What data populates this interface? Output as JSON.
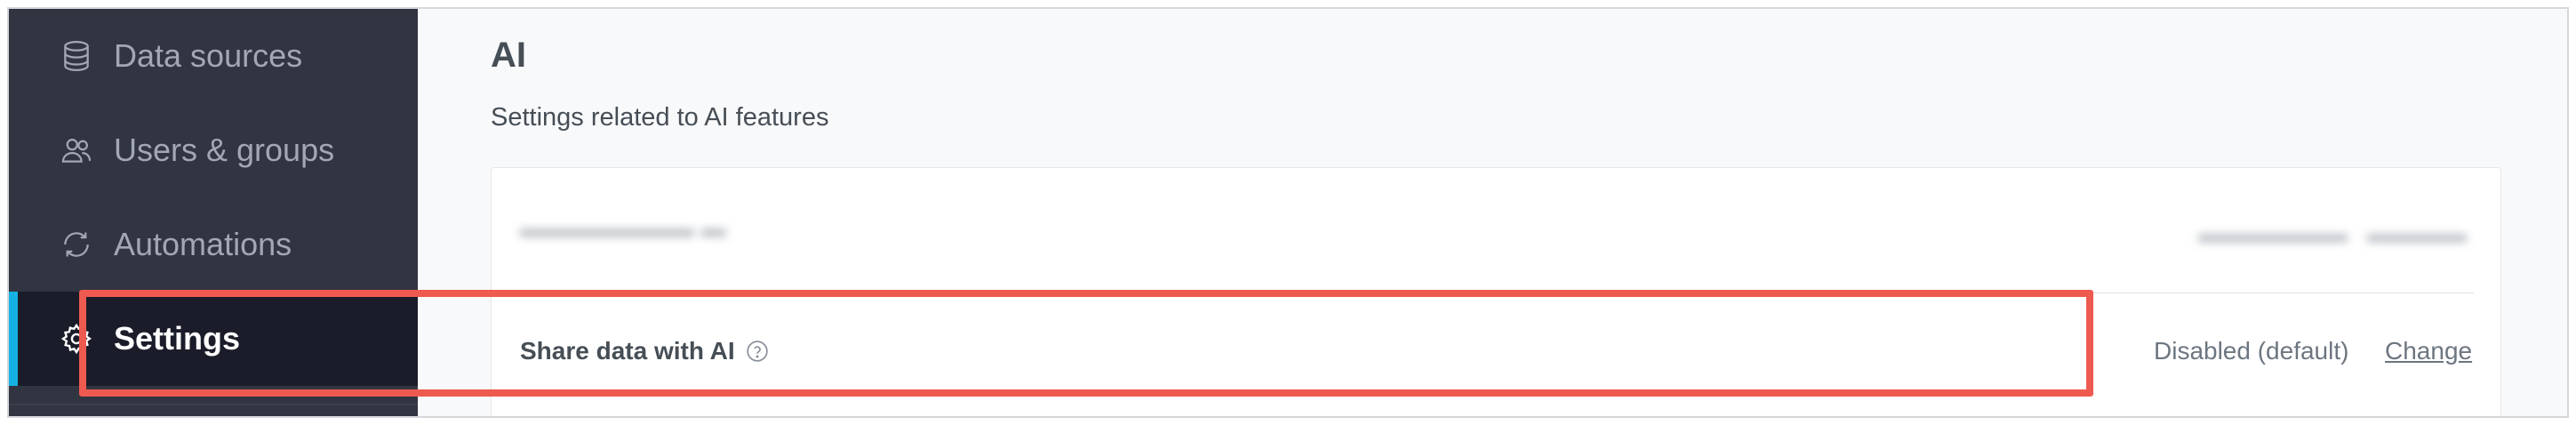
{
  "sidebar": {
    "items": [
      {
        "label": "Data sources",
        "icon": "database-icon"
      },
      {
        "label": "Users & groups",
        "icon": "users-icon"
      },
      {
        "label": "Automations",
        "icon": "refresh-icon"
      },
      {
        "label": "Settings",
        "icon": "gear-icon",
        "active": true
      }
    ]
  },
  "main": {
    "title": "AI",
    "subtitle": "Settings related to AI features",
    "share_row": {
      "label": "Share data with AI",
      "status": "Disabled (default)",
      "action": "Change"
    }
  },
  "colors": {
    "sidebar_bg": "#313441",
    "active_bg": "#1a1d29",
    "accent": "#14b2e2",
    "highlight": "#ee5a4f"
  }
}
